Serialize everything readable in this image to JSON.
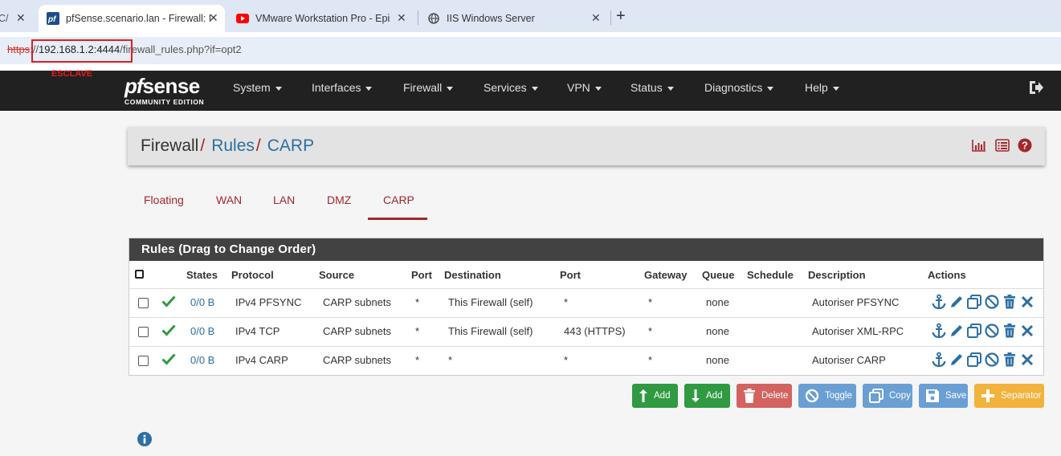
{
  "browser": {
    "tabs": [
      {
        "title": "C/",
        "active": false
      },
      {
        "title": "pfSense.scenario.lan - Firewall: R",
        "active": true,
        "favicon": "pfsense-icon"
      },
      {
        "title": "VMware Workstation Pro - Episo",
        "active": false,
        "favicon": "youtube-icon"
      },
      {
        "title": "IIS Windows Server",
        "active": false,
        "favicon": "globe-icon"
      }
    ],
    "new_tab": "+",
    "url": {
      "scheme": "https",
      "sep": "://",
      "host": "192.168.1.2:4444",
      "path": "/firewall_rules.php?if=opt2"
    },
    "annotation": "ESCLAVE",
    "highlight_color": "#e01f1f"
  },
  "brand": {
    "pf": "pf",
    "sense": "sense",
    "edition": "COMMUNITY EDITION"
  },
  "nav": {
    "items": [
      "System",
      "Interfaces",
      "Firewall",
      "Services",
      "VPN",
      "Status",
      "Diagnostics",
      "Help"
    ],
    "logout_icon": "logout-icon"
  },
  "breadcrumb": {
    "root": "Firewall",
    "rules": "Rules",
    "current": "CARP",
    "sep": "/"
  },
  "subtabs": {
    "items": [
      "Floating",
      "WAN",
      "LAN",
      "DMZ",
      "CARP"
    ],
    "active": "CARP"
  },
  "rules": {
    "title": "Rules (Drag to Change Order)",
    "headers": [
      "States",
      "Protocol",
      "Source",
      "Port",
      "Destination",
      "Port",
      "Gateway",
      "Queue",
      "Schedule",
      "Description",
      "Actions"
    ],
    "rows": [
      {
        "states": "0/0 B",
        "protocol": "IPv4 PFSYNC",
        "source": "CARP subnets",
        "sport": "*",
        "destination": "This Firewall (self)",
        "dport": "*",
        "gateway": "*",
        "queue": "none",
        "schedule": "",
        "description": "Autoriser PFSYNC"
      },
      {
        "states": "0/0 B",
        "protocol": "IPv4 TCP",
        "source": "CARP subnets",
        "sport": "*",
        "destination": "This Firewall (self)",
        "dport": "443 (HTTPS)",
        "gateway": "*",
        "queue": "none",
        "schedule": "",
        "description": "Autoriser XML-RPC"
      },
      {
        "states": "0/0 B",
        "protocol": "IPv4 CARP",
        "source": "CARP subnets",
        "sport": "*",
        "destination": "*",
        "dport": "*",
        "gateway": "*",
        "queue": "none",
        "schedule": "",
        "description": "Autoriser CARP"
      }
    ],
    "action_icons": [
      "anchor-icon",
      "pencil-icon",
      "copy-icon",
      "ban-icon",
      "trash-icon",
      "times-icon"
    ]
  },
  "buttons": {
    "add_top": "Add",
    "add_bottom": "Add",
    "delete": "Delete",
    "toggle": "Toggle",
    "copy": "Copy",
    "save": "Save",
    "separator": "Separator"
  },
  "colors": {
    "accent": "#a4262c",
    "link": "#2c6fa4",
    "navbar": "#212121",
    "success": "#2f9a42"
  }
}
